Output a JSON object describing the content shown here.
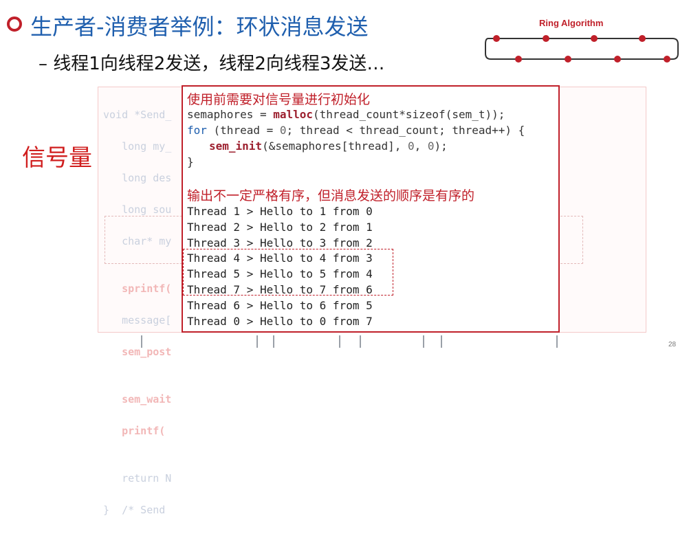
{
  "slide": {
    "title": "生产者-消费者举例：环状消息发送",
    "subtitle": "– 线程1向线程2发送，线程2向线程3发送…",
    "ring_label": "Ring Algorithm",
    "sem_label": "信号量",
    "page_number": "28",
    "accent_color": "#c0202a",
    "title_color": "#1f5fae"
  },
  "background_code": {
    "lines": [
      "void *Send_",
      "   long my_",
      "   long des",
      "   long sou",
      "   char* my",
      "",
      "   sprintf(",
      "   message[",
      "   sem_post",
      "",
      "   sem_wait",
      "   printf(",
      "",
      "   return N",
      "}  /* Send"
    ]
  },
  "overlay": {
    "init_note": "使用前需要对信号量进行初始化",
    "code": {
      "line1_a": "semaphores = ",
      "line1_fn": "malloc",
      "line1_b": "(thread_count*sizeof(sem_t));",
      "line2_kw": "for",
      "line2_b": " (thread = ",
      "line2_n0": "0",
      "line2_c": "; thread < thread_count; thread++) {",
      "line3_fn": "sem_init",
      "line3_b": "(&semaphores[thread], ",
      "line3_n1": "0",
      "line3_c": ", ",
      "line3_n2": "0",
      "line3_d": ");",
      "line4": "}"
    },
    "output_note": "输出不一定严格有序，但消息发送的顺序是有序的",
    "output_lines": [
      "Thread 1 > Hello to 1 from 0",
      "Thread 2 > Hello to 2 from 1",
      "Thread 3 > Hello to 3 from 2",
      "Thread 4 > Hello to 4 from 3",
      "Thread 5 > Hello to 5 from 4",
      "Thread 7 > Hello to 7 from 6",
      "Thread 6 > Hello to 6 from 5",
      "Thread 0 > Hello to 0 from 7"
    ]
  }
}
